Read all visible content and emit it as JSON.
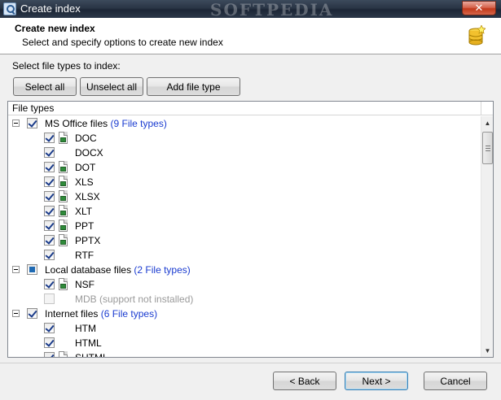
{
  "window": {
    "title": "Create index",
    "close_label": "✕",
    "watermark": "SOFTPEDIA"
  },
  "header": {
    "title": "Create new index",
    "subtitle": "Select and specify options to create new index"
  },
  "select_label": "Select file types to index:",
  "toolbar": {
    "select_all": "Select all",
    "unselect_all": "Unselect all",
    "add_file_type": "Add file type"
  },
  "tree": {
    "column_header": "File types",
    "groups": [
      {
        "label": "MS Office files",
        "count": "(9 File types)",
        "state": "checked",
        "items": [
          {
            "label": "DOC",
            "checked": true,
            "has_icon": true
          },
          {
            "label": "DOCX",
            "checked": true,
            "has_icon": false
          },
          {
            "label": "DOT",
            "checked": true,
            "has_icon": true
          },
          {
            "label": "XLS",
            "checked": true,
            "has_icon": true
          },
          {
            "label": "XLSX",
            "checked": true,
            "has_icon": true
          },
          {
            "label": "XLT",
            "checked": true,
            "has_icon": true
          },
          {
            "label": "PPT",
            "checked": true,
            "has_icon": true
          },
          {
            "label": "PPTX",
            "checked": true,
            "has_icon": true
          },
          {
            "label": "RTF",
            "checked": true,
            "has_icon": false
          }
        ]
      },
      {
        "label": "Local database files",
        "count": "(2 File types)",
        "state": "partial",
        "items": [
          {
            "label": "NSF",
            "checked": true,
            "has_icon": true
          },
          {
            "label": "MDB (support not installed)",
            "checked": false,
            "has_icon": false,
            "disabled": true
          }
        ]
      },
      {
        "label": "Internet files",
        "count": "(6 File types)",
        "state": "checked",
        "items": [
          {
            "label": "HTM",
            "checked": true,
            "has_icon": false
          },
          {
            "label": "HTML",
            "checked": true,
            "has_icon": false
          },
          {
            "label": "SHTML",
            "checked": true,
            "has_icon": true
          }
        ]
      }
    ]
  },
  "footer": {
    "back": "< Back",
    "next": "Next >",
    "cancel": "Cancel"
  },
  "icons": {
    "app": "search-magnifier-icon",
    "header": "database-star-icon",
    "file": "document-icon"
  },
  "colors": {
    "count_text": "#1a3bd0",
    "disabled_text": "#9a9a9a"
  }
}
